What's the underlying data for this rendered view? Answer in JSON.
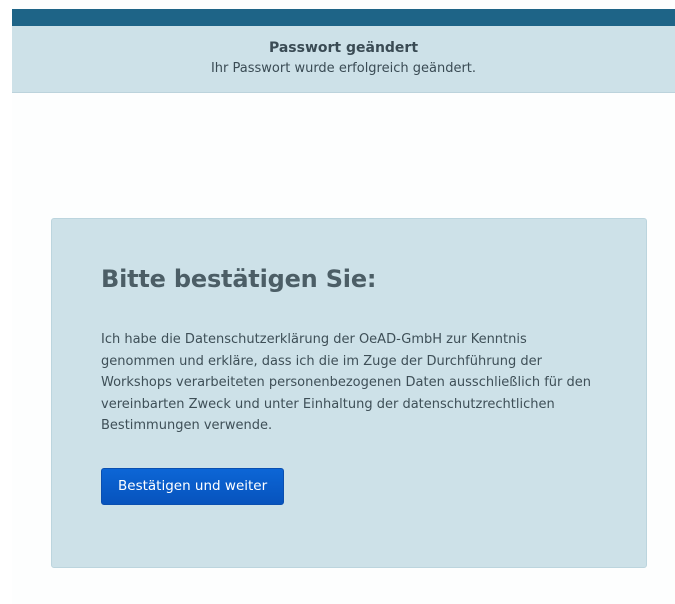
{
  "notice": {
    "title": "Passwort geändert",
    "message": "Ihr Passwort wurde erfolgreich geändert."
  },
  "consent": {
    "heading": "Bitte bestätigen Sie:",
    "text": "Ich habe die Datenschutzerklärung der OeAD-GmbH zur Kenntnis genommen und erkläre, dass ich die im Zuge der Durchführung der Workshops verarbeiteten personenbezogenen Daten ausschließlich für den vereinbarten Zweck und unter Einhaltung der datenschutzrechtlichen Bestimmungen verwende.",
    "button_label": "Bestätigen und weiter"
  },
  "colors": {
    "top_bar": "#1e6487",
    "panel_background": "#cde1e8",
    "button": "#0a5cc8",
    "heading_text": "#4c5e66"
  }
}
